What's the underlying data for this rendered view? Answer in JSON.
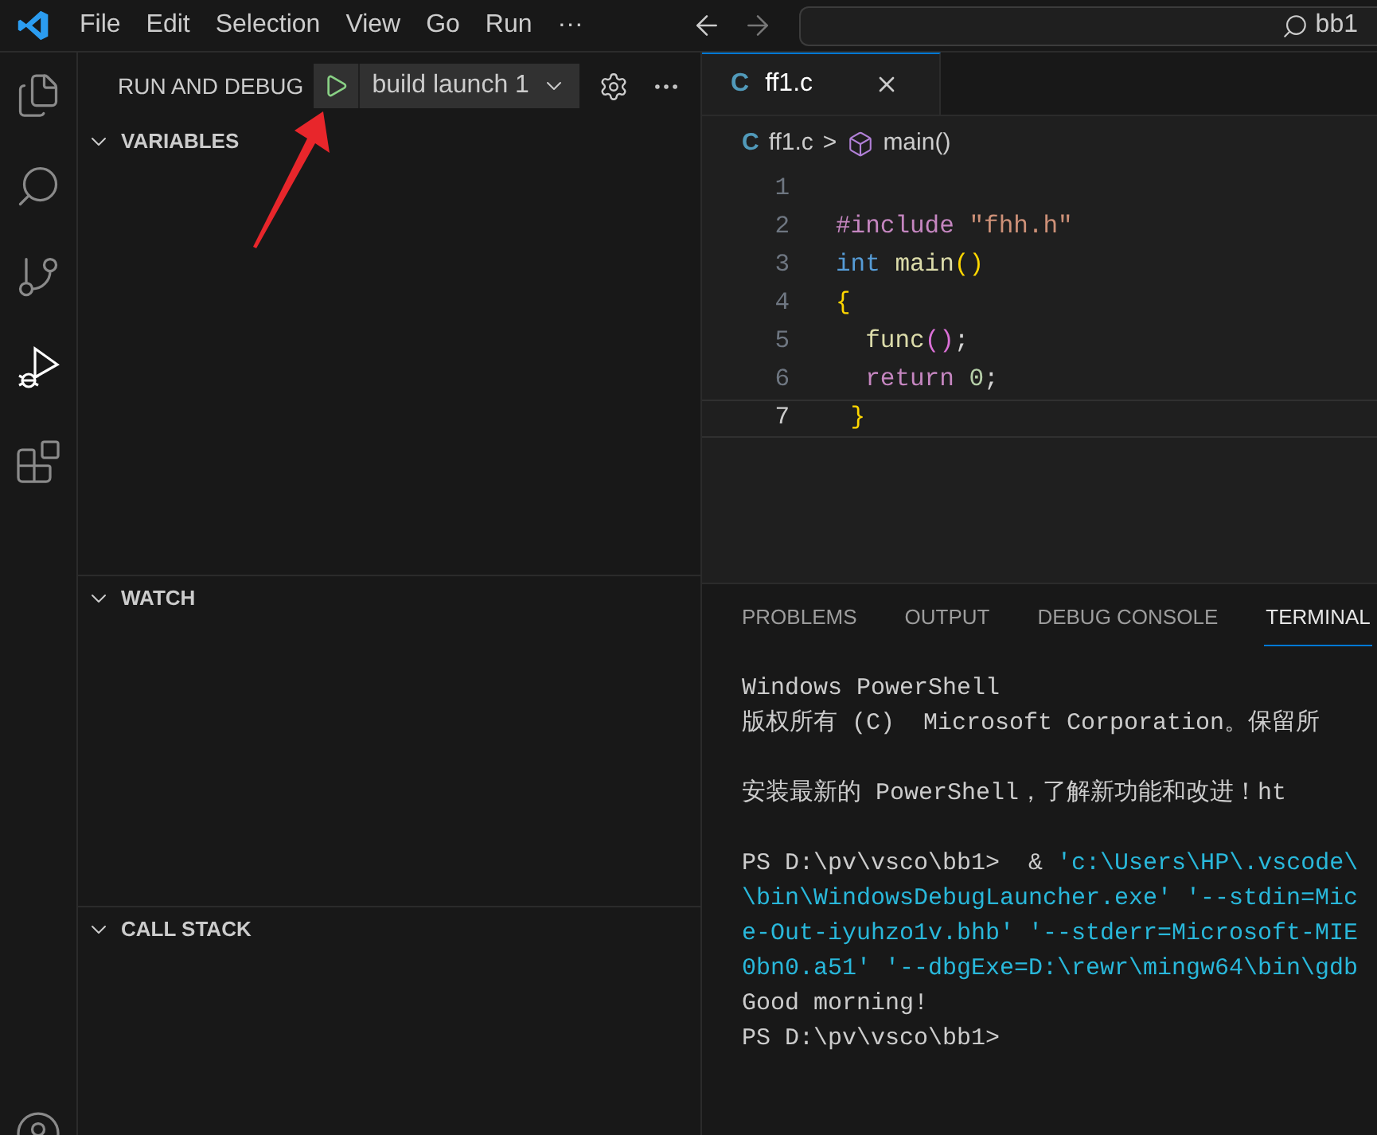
{
  "menu_bar": {
    "items": [
      "File",
      "Edit",
      "Selection",
      "View",
      "Go",
      "Run",
      "···"
    ],
    "search": {
      "value": "bb1"
    }
  },
  "activity_bar": {
    "items": [
      {
        "kind": "files",
        "selected": false
      },
      {
        "kind": "search",
        "selected": false
      },
      {
        "kind": "source-control",
        "selected": false
      },
      {
        "kind": "run-debug",
        "selected": true
      },
      {
        "kind": "extensions",
        "selected": false
      }
    ]
  },
  "sidebar": {
    "title": "RUN AND DEBUG",
    "configuration": "build launch 1",
    "sections": [
      {
        "label": "VARIABLES",
        "expanded": true
      },
      {
        "label": "WATCH",
        "expanded": true
      },
      {
        "label": "CALL STACK",
        "expanded": true
      }
    ]
  },
  "editor": {
    "tabs": [
      {
        "icon": "C",
        "label": "ff1.c",
        "selected": true
      }
    ],
    "breadcrumb": {
      "file_icon": "C",
      "file": "ff1.c",
      "separator": ">",
      "symbol": "main()"
    },
    "lines": [
      {
        "number": "1",
        "selected": false
      },
      {
        "number": "2",
        "selected": false,
        "tokens": [
          {
            "text": "#include",
            "kind": "directive"
          },
          {
            "text": " \"fhh.h\"",
            "kind": "string"
          }
        ]
      },
      {
        "number": "3",
        "selected": false,
        "tokens": [
          {
            "text": "int",
            "kind": "type"
          },
          {
            "text": " main",
            "kind": "function"
          },
          {
            "text": "()",
            "kind": "bracket"
          }
        ]
      },
      {
        "number": "4",
        "selected": false,
        "tokens": [
          {
            "text": "{",
            "kind": "bracket"
          }
        ]
      },
      {
        "number": "5",
        "selected": false,
        "tokens": [
          {
            "text": "  func",
            "kind": "function"
          },
          {
            "text": "()",
            "kind": "bracket2"
          },
          {
            "text": ";",
            "kind": "plain"
          }
        ]
      },
      {
        "number": "6",
        "selected": false,
        "tokens": [
          {
            "text": "  return",
            "kind": "keyword"
          },
          {
            "text": " 0",
            "kind": "number"
          },
          {
            "text": ";",
            "kind": "plain"
          }
        ]
      },
      {
        "number": "7",
        "selected": true,
        "tokens": [
          {
            "text": " }",
            "kind": "bracket"
          }
        ]
      }
    ]
  },
  "panel": {
    "tabs": [
      {
        "label": "PROBLEMS",
        "selected": false
      },
      {
        "label": "OUTPUT",
        "selected": false
      },
      {
        "label": "DEBUG CONSOLE",
        "selected": false
      },
      {
        "label": "TERMINAL",
        "selected": true
      }
    ],
    "terminal": [
      {
        "gap_before": false,
        "segments": [
          {
            "text": "Windows PowerShell",
            "kind": "plain"
          }
        ]
      },
      {
        "gap_before": false,
        "segments": [
          {
            "text": "版权所有 (C)  Microsoft Corporation。保留所",
            "kind": "plain"
          }
        ]
      },
      {
        "gap_before": true,
        "segments": [
          {
            "text": "安装最新的 PowerShell，了解新功能和改进！ht",
            "kind": "plain"
          }
        ]
      },
      {
        "gap_before": true,
        "segments": [
          {
            "text": "PS D:\\pv\\vsco\\bb1>  & ",
            "kind": "plain"
          },
          {
            "text": "'c:\\Users\\HP\\.vscode\\",
            "kind": "command"
          }
        ]
      },
      {
        "gap_before": false,
        "segments": [
          {
            "text": "\\bin\\WindowsDebugLauncher.exe' '--stdin=Mic",
            "kind": "command"
          }
        ]
      },
      {
        "gap_before": false,
        "segments": [
          {
            "text": "e-Out-iyuhzo1v.bhb' '--stderr=Microsoft-MIE",
            "kind": "command"
          }
        ]
      },
      {
        "gap_before": false,
        "segments": [
          {
            "text": "0bn0.a51' '--dbgExe=D:\\rewr\\mingw64\\bin\\gdb",
            "kind": "command"
          }
        ]
      },
      {
        "gap_before": false,
        "segments": [
          {
            "text": "Good morning!",
            "kind": "plain"
          }
        ]
      },
      {
        "gap_before": false,
        "segments": [
          {
            "text": "PS D:\\pv\\vsco\\bb1>",
            "kind": "plain"
          }
        ]
      }
    ]
  }
}
